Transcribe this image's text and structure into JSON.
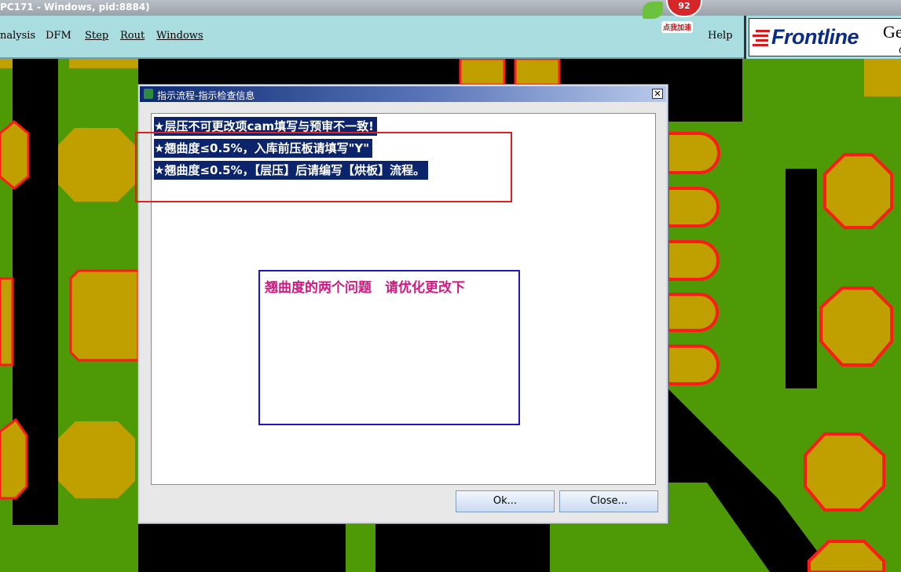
{
  "window": {
    "title": "PC171 - Windows, pid:8884)"
  },
  "menubar": {
    "items": [
      "nalysis",
      "DFM",
      "Step",
      "Rout",
      "Windows"
    ],
    "help": "Help"
  },
  "speed_widget": {
    "value": "92",
    "label": "点我加速"
  },
  "logo": {
    "text": "Frontline",
    "ge": "Ge",
    "c": "C"
  },
  "dialog": {
    "title": "指示流程-指示检查信息",
    "close_glyph": "✕",
    "messages": [
      "★层压不可更改项cam填写与预审不一致!",
      "★翘曲度≤0.5%，入库前压板请填写\"Y\"",
      "★翘曲度≤0.5%，【层压】后请编写【烘板】流程。"
    ],
    "ok_label": "Ok...",
    "close_label": "Close..."
  },
  "annotation": {
    "note": "翘曲度的两个问题　请优化更改下"
  },
  "colors": {
    "pcb_background": "#000000",
    "copper_green": "#4e9a06",
    "pad_gold": "#c0a000",
    "pad_outline_red": "#ff1a1a",
    "menubar": "#a9dde0",
    "selection": "#0b246b",
    "annotation_text": "#d01880"
  }
}
